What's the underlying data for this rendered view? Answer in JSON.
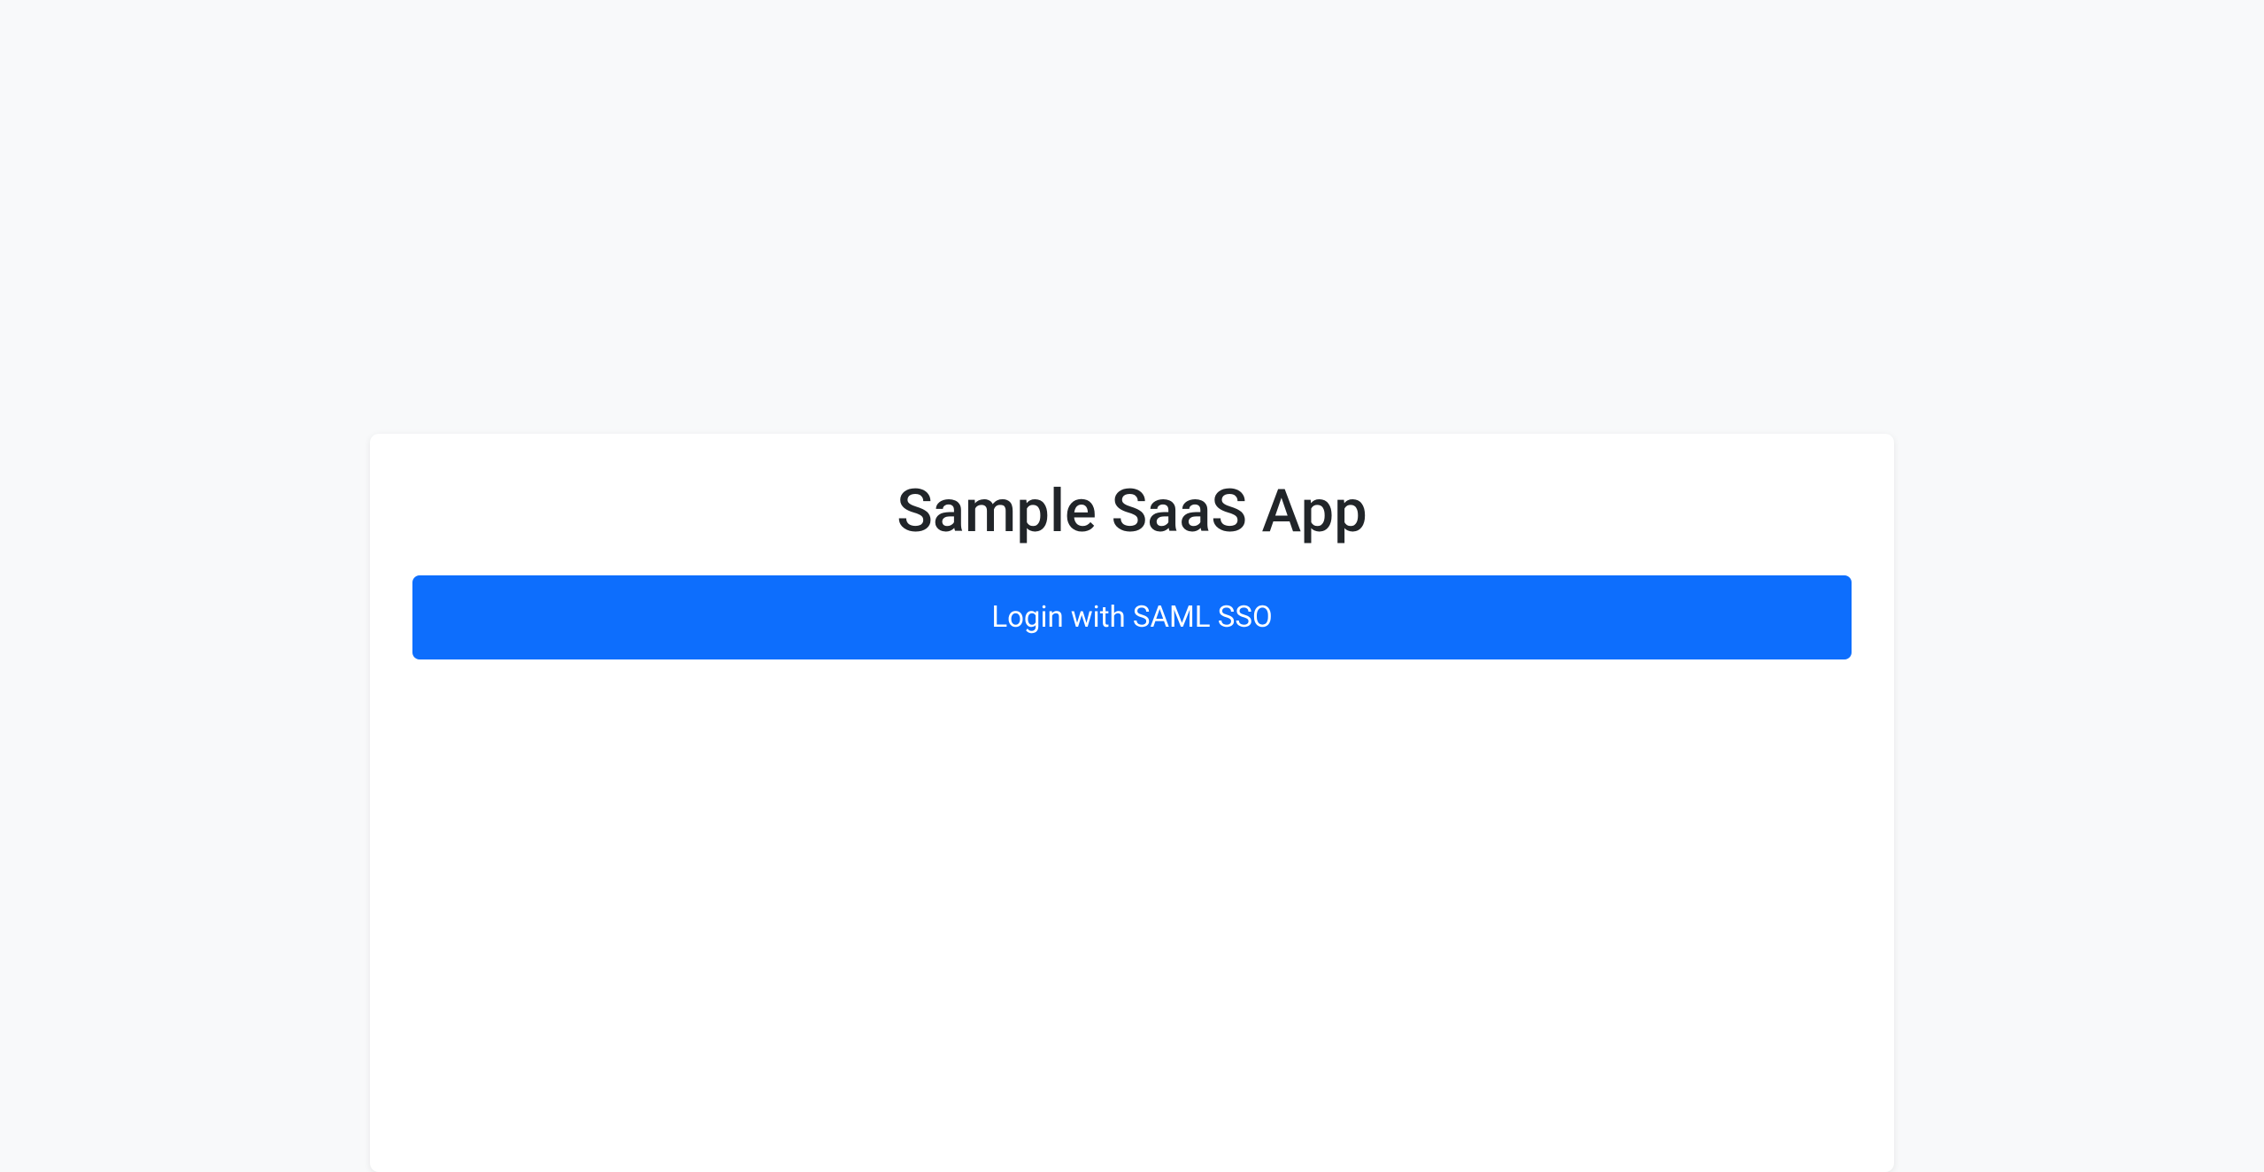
{
  "card": {
    "title": "Sample SaaS App",
    "loginButtonLabel": "Login with SAML SSO"
  }
}
